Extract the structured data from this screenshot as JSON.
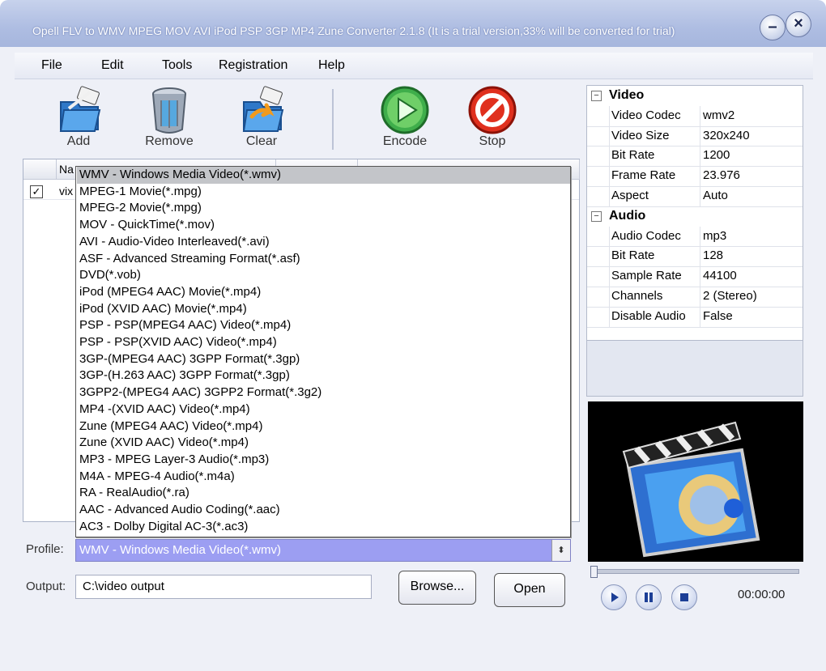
{
  "window": {
    "title": "Opell FLV to WMV MPEG MOV AVI iPod PSP 3GP MP4 Zune Converter 2.1.8 (It is a trial version,33% will be converted for trial)"
  },
  "menu": {
    "file": "File",
    "edit": "Edit",
    "tools": "Tools",
    "registration": "Registration",
    "help": "Help"
  },
  "toolbar": {
    "add": "Add",
    "remove": "Remove",
    "clear": "Clear",
    "encode": "Encode",
    "stop": "Stop"
  },
  "file_table": {
    "name_header": "Na",
    "row1_name": "vix",
    "row1_checked": true
  },
  "formats": [
    "WMV - Windows Media Video(*.wmv)",
    "MPEG-1 Movie(*.mpg)",
    "MPEG-2 Movie(*.mpg)",
    "MOV - QuickTime(*.mov)",
    "AVI - Audio-Video Interleaved(*.avi)",
    "ASF - Advanced Streaming Format(*.asf)",
    "DVD(*.vob)",
    "iPod (MPEG4 AAC) Movie(*.mp4)",
    "iPod (XVID AAC) Movie(*.mp4)",
    "PSP - PSP(MPEG4 AAC) Video(*.mp4)",
    "PSP - PSP(XVID AAC) Video(*.mp4)",
    "3GP-(MPEG4 AAC) 3GPP Format(*.3gp)",
    "3GP-(H.263 AAC) 3GPP Format(*.3gp)",
    "3GPP2-(MPEG4 AAC) 3GPP2 Format(*.3g2)",
    "MP4 -(XVID AAC) Video(*.mp4)",
    "Zune (MPEG4 AAC) Video(*.mp4)",
    "Zune (XVID AAC) Video(*.mp4)",
    "MP3 - MPEG Layer-3 Audio(*.mp3)",
    "M4A - MPEG-4 Audio(*.m4a)",
    "RA - RealAudio(*.ra)",
    "AAC - Advanced Audio Coding(*.aac)",
    "AC3 - Dolby Digital AC-3(*.ac3)"
  ],
  "profile": {
    "label": "Profile:",
    "value": "WMV - Windows Media Video(*.wmv)"
  },
  "output": {
    "label": "Output:",
    "value": "C:\\video output",
    "browse": "Browse...",
    "open": "Open"
  },
  "properties": {
    "video_category": "Video",
    "video": [
      {
        "name": "Video Codec",
        "value": "wmv2"
      },
      {
        "name": "Video Size",
        "value": "320x240"
      },
      {
        "name": "Bit Rate",
        "value": "1200"
      },
      {
        "name": "Frame Rate",
        "value": "23.976"
      },
      {
        "name": "Aspect",
        "value": "Auto"
      }
    ],
    "audio_category": "Audio",
    "audio": [
      {
        "name": "Audio Codec",
        "value": "mp3"
      },
      {
        "name": "Bit Rate",
        "value": "128"
      },
      {
        "name": "Sample Rate",
        "value": "44100"
      },
      {
        "name": "Channels",
        "value": "2 (Stereo)"
      },
      {
        "name": "Disable Audio",
        "value": "False"
      }
    ]
  },
  "player": {
    "time": "00:00:00",
    "progress": 0
  },
  "colors": {
    "selection_bg": "#c3c5c9",
    "profile_bg": "#9c9ef2",
    "titlebar": "#aebde2"
  }
}
